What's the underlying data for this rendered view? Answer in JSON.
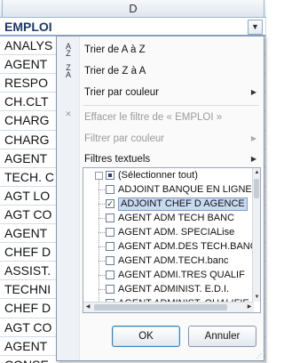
{
  "column": {
    "letter": "D"
  },
  "cells": [
    "EMPLOI",
    "ANALYS",
    "AGENT",
    "RESPO",
    "CH.CLT",
    "CHARG",
    "CHARG",
    "AGENT",
    "TECH. C",
    "AGT LO",
    "AGT CO",
    "AGENT",
    "CHEF D",
    "ASSIST.",
    "TECHNI",
    "CHEF D",
    "AGT CO",
    "AGENT",
    "CONSE"
  ],
  "filter_button": {
    "icon": "dropdown-arrow-icon"
  },
  "menu": {
    "sort_az": "Trier de A à Z",
    "sort_za": "Trier de Z à A",
    "sort_color": "Trier par couleur",
    "clear_filter": "Effacer le filtre de « EMPLOI »",
    "filter_color": "Filtrer par couleur",
    "text_filters": "Filtres textuels"
  },
  "list": {
    "select_all": "(Sélectionner tout)",
    "items": [
      {
        "label": "ADJOINT BANQUE EN LIGNE",
        "checked": false
      },
      {
        "label": "ADJOINT CHEF D AGENCE",
        "checked": true
      },
      {
        "label": "AGENT ADM TECH BANC",
        "checked": false
      },
      {
        "label": "AGENT ADM. SPECIALise",
        "checked": false
      },
      {
        "label": "AGENT ADM.DES TECH.BANC",
        "checked": false
      },
      {
        "label": "AGENT ADM.TECH.banc",
        "checked": false
      },
      {
        "label": "AGENT ADMI.TRES QUALIF",
        "checked": false
      },
      {
        "label": "AGENT ADMINIST. E.D.I.",
        "checked": false
      },
      {
        "label": "AGENT ADMINIST. QUALIFIE",
        "checked": false
      }
    ]
  },
  "buttons": {
    "ok": "OK",
    "cancel": "Annuler"
  }
}
